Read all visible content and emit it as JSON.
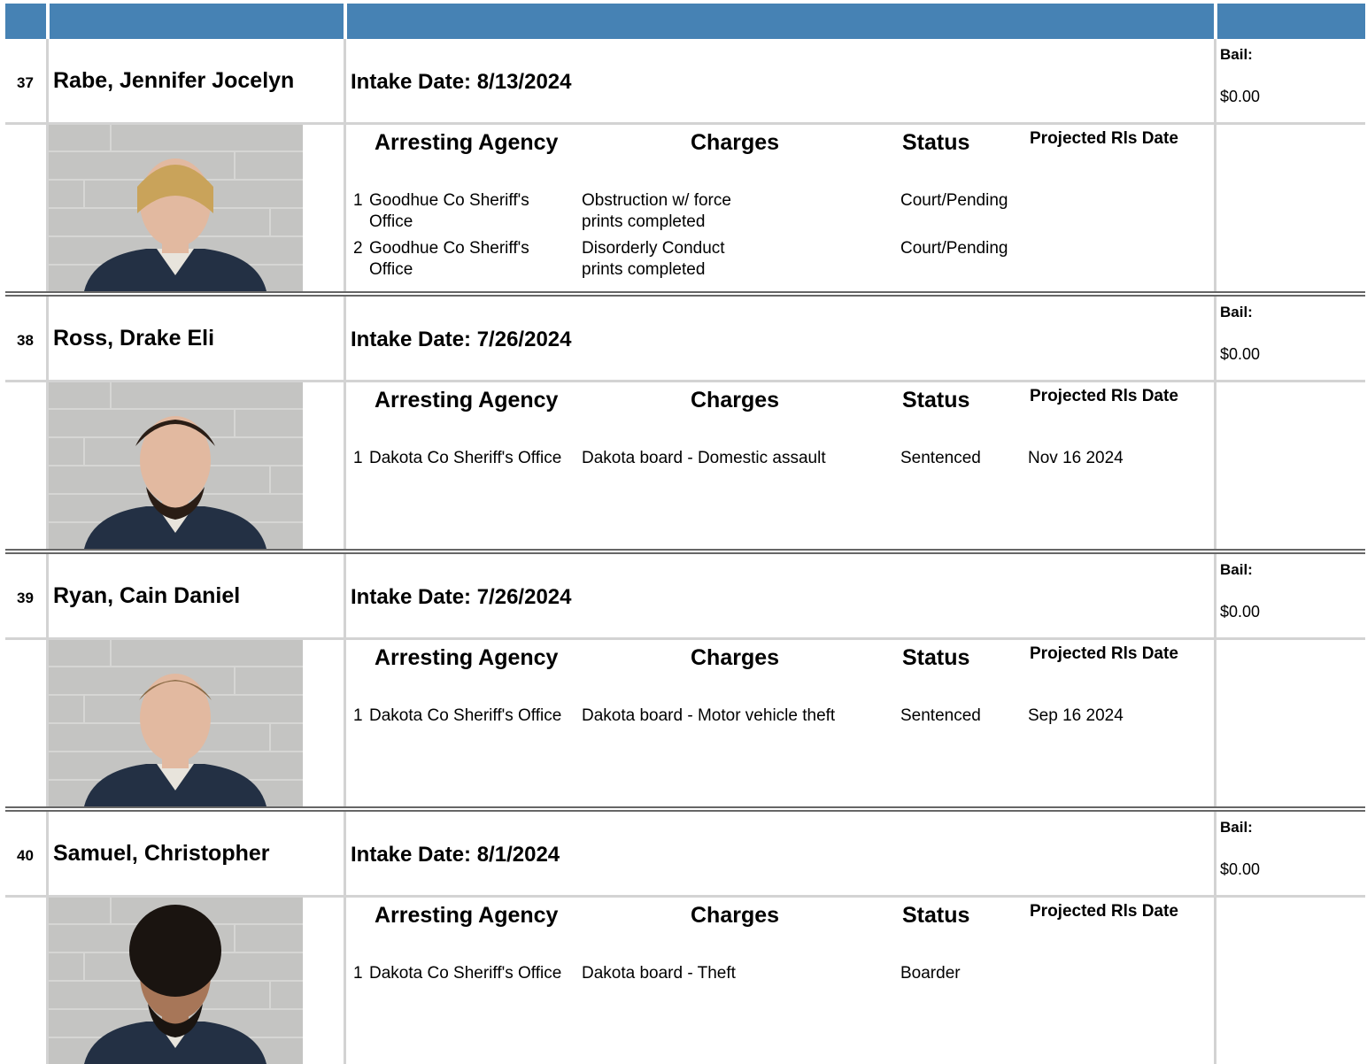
{
  "header": {
    "colors": {
      "header_bar": "#4682b4",
      "grid": "#d3d3d3"
    }
  },
  "column_labels": {
    "agency": "Arresting Agency",
    "charges": "Charges",
    "status": "Status",
    "release": "Projected Rls Date",
    "bail": "Bail:"
  },
  "inmates": [
    {
      "number": "37",
      "name": "Rabe, Jennifer Jocelyn",
      "intake": "Intake Date: 8/13/2024",
      "bail_value": "$0.00",
      "photo": "mugshot-female-blonde",
      "charges": [
        {
          "n": "1",
          "agency": "Goodhue Co Sheriff's Office",
          "charge": "Obstruction w/ force",
          "note": "prints completed",
          "status": "Court/Pending",
          "release": ""
        },
        {
          "n": "2",
          "agency": "Goodhue Co Sheriff's Office",
          "charge": "Disorderly Conduct",
          "note": "prints completed",
          "status": "Court/Pending",
          "release": ""
        }
      ]
    },
    {
      "number": "38",
      "name": "Ross, Drake Eli",
      "intake": "Intake Date: 7/26/2024",
      "bail_value": "$0.00",
      "photo": "mugshot-male-bearded",
      "charges": [
        {
          "n": "1",
          "agency": "Dakota Co Sheriff's Office",
          "charge": "Dakota board - Domestic assault",
          "note": "",
          "status": "Sentenced",
          "release": "Nov 16 2024"
        }
      ]
    },
    {
      "number": "39",
      "name": "Ryan, Cain Daniel",
      "intake": "Intake Date: 7/26/2024",
      "bail_value": "$0.00",
      "photo": "mugshot-male",
      "charges": [
        {
          "n": "1",
          "agency": "Dakota Co Sheriff's Office",
          "charge": "Dakota board - Motor vehicle theft",
          "note": "",
          "status": "Sentenced",
          "release": "Sep 16 2024"
        }
      ]
    },
    {
      "number": "40",
      "name": "Samuel, Christopher",
      "intake": "Intake Date: 8/1/2024",
      "bail_value": "$0.00",
      "photo": "mugshot-male-curly",
      "charges": [
        {
          "n": "1",
          "agency": "Dakota Co Sheriff's Office",
          "charge": "Dakota board - Theft",
          "note": "",
          "status": "Boarder",
          "release": ""
        }
      ]
    }
  ]
}
